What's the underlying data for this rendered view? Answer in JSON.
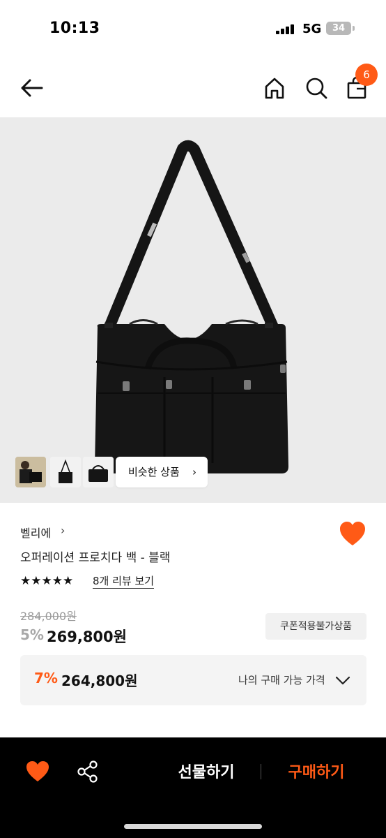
{
  "status_bar": {
    "time": "10:13",
    "network": "5G",
    "battery": "34"
  },
  "header": {
    "cart_count": "6",
    "icons": [
      "back-arrow-icon",
      "home-icon",
      "search-icon",
      "shopping-bag-icon"
    ]
  },
  "gallery": {
    "thumbnails": [
      "thumbnail-1",
      "thumbnail-2",
      "thumbnail-3"
    ],
    "similar_label": "비슷한 상품",
    "similar_chevron": "›"
  },
  "product": {
    "brand": "벨리에",
    "brand_chevron": "›",
    "title": "오퍼레이션 프로치다 백 - 블랙",
    "rating_stars": "★★★★★",
    "review_link": "8개 리뷰 보기",
    "liked": true
  },
  "price": {
    "original": "284,000원",
    "discount_rate": "5%",
    "sale": "269,800원",
    "coupon_note": "쿠폰적용불가상품"
  },
  "my_price": {
    "discount_rate": "7%",
    "price": "264,800원",
    "label": "나의 구매 가능 가격"
  },
  "bottom_bar": {
    "gift_label": "선물하기",
    "buy_label": "구매하기"
  },
  "colors": {
    "accent": "#ff5a16",
    "bottom_bar": "#000000"
  }
}
